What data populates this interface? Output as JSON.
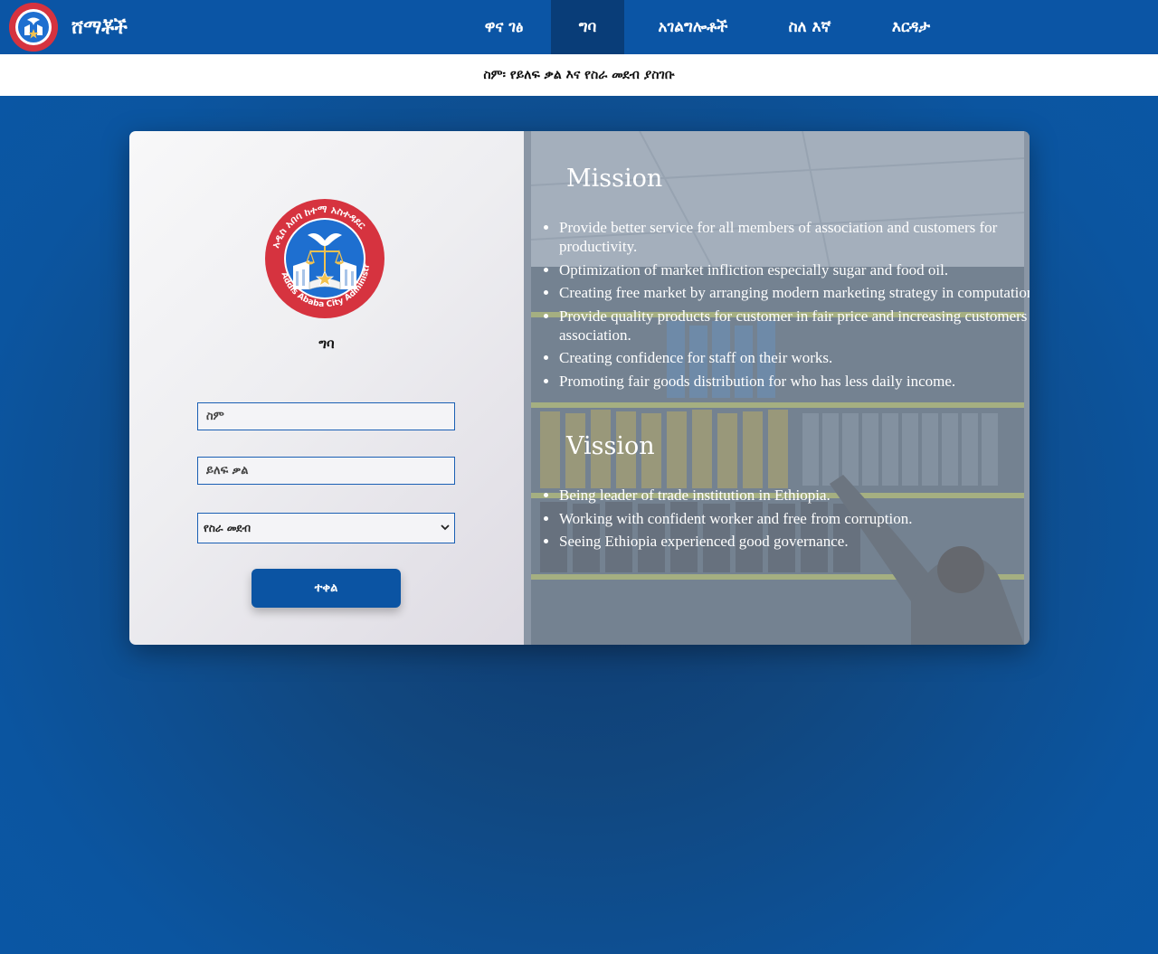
{
  "nav": {
    "brand": "ሸማቾች",
    "items": [
      {
        "label": "ዋና ገፅ",
        "active": false
      },
      {
        "label": "ግባ",
        "active": true
      },
      {
        "label": "አገልግሎቶች",
        "active": false
      },
      {
        "label": "ስለ እኛ",
        "active": false
      },
      {
        "label": "እርዳታ",
        "active": false
      }
    ]
  },
  "subheader": {
    "text": "ስም፡ የይለፍ ቃል እና የስራ መደብ ያስገቡ"
  },
  "login": {
    "seal": {
      "top_text": "አዲስ አበባ ከተማ አስተዳደር",
      "bottom_text": "Addis Ababa City Administration"
    },
    "title": "ግባ",
    "username_placeholder": "ስም",
    "password_placeholder": "ይለፍ ቃል",
    "role_selected": "የስራ መደብ",
    "submit_label": "ተቀል"
  },
  "mission": {
    "heading": "Mission",
    "items": [
      "Provide better service for all members of association and customers for productivity.",
      "Optimization of market infliction especially sugar and food oil.",
      "Creating free market by arranging modern marketing strategy in computation.",
      "Provide quality products for customer in fair price and increasing customers of association.",
      "Creating confidence for staff on their works.",
      "Promoting fair goods distribution for who has less daily income."
    ]
  },
  "vision": {
    "heading": "Vission",
    "items": [
      "Being leader of trade institution in Ethiopia.",
      "Working with confident worker and free from corruption.",
      "Seeing Ethiopia experienced good governance."
    ]
  },
  "colors": {
    "nav_bg": "#0b55a5",
    "nav_active_bg": "#093d78",
    "button_bg": "#0b54a3",
    "field_border": "#1a5fb4",
    "seal_red": "#d6333f",
    "seal_blue": "#1e6fd0"
  }
}
